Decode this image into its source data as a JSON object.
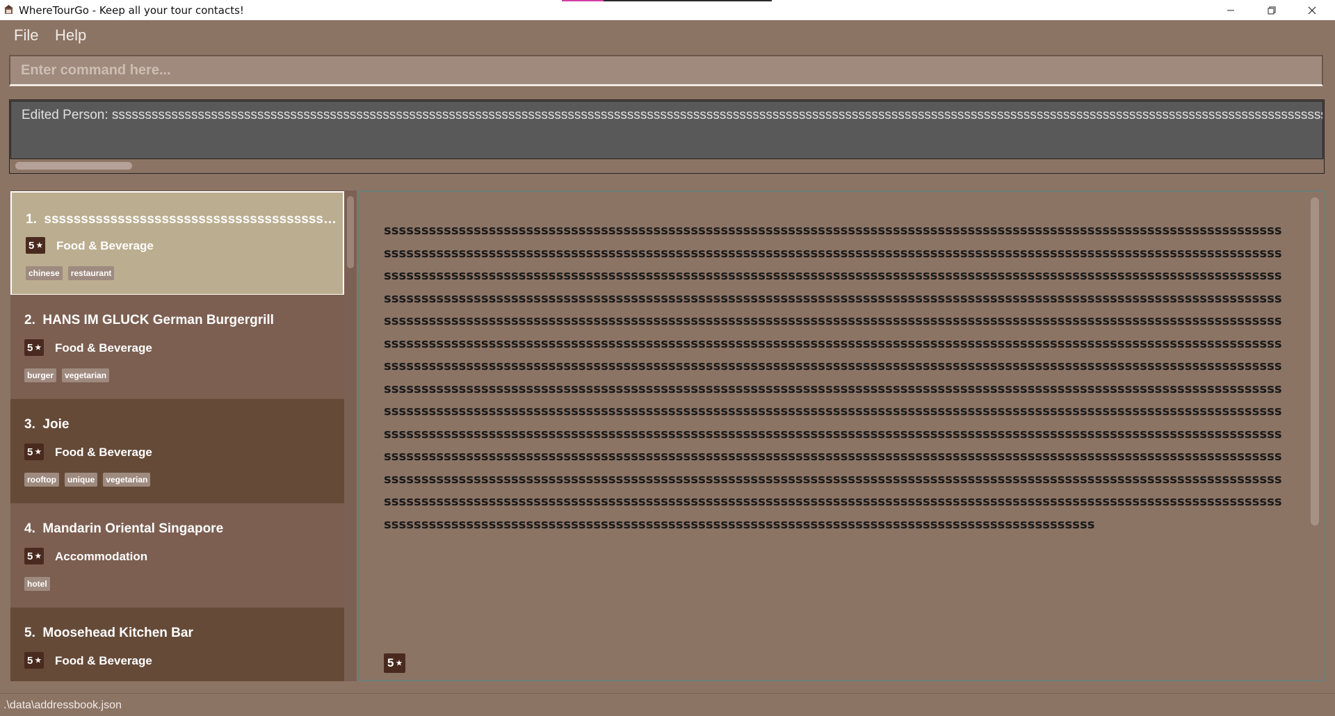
{
  "window": {
    "title": "WhereTourGo - Keep all your tour contacts!"
  },
  "menu": {
    "file": "File",
    "help": "Help"
  },
  "command": {
    "placeholder": "Enter command here..."
  },
  "result": {
    "message": "Edited Person: sssssssssssssssssssssssssssssssssssssssssssssssssssssssssssssssssssssssssssssssssssssssssssssssssssssssssssssssssssssssssssssssssssssssssssssssssssssssssssssssssssssssssssssssssssssssssssssssssssssssssssssssssssssssssssssssssssssssssssssss"
  },
  "list": {
    "items": [
      {
        "index": "1.",
        "name": "sssssssssssssssssssssssssssssssssssssssssssssssssssssss",
        "rating": "5",
        "category": "Food & Beverage",
        "tags": [
          "chinese",
          "restaurant"
        ]
      },
      {
        "index": "2.",
        "name": "HANS IM GLUCK German Burgergrill",
        "rating": "5",
        "category": "Food & Beverage",
        "tags": [
          "burger",
          "vegetarian"
        ]
      },
      {
        "index": "3.",
        "name": "Joie",
        "rating": "5",
        "category": "Food & Beverage",
        "tags": [
          "rooftop",
          "unique",
          "vegetarian"
        ]
      },
      {
        "index": "4.",
        "name": "Mandarin Oriental Singapore",
        "rating": "5",
        "category": "Accommodation",
        "tags": [
          "hotel"
        ]
      },
      {
        "index": "5.",
        "name": "Moosehead Kitchen Bar",
        "rating": "5",
        "category": "Food & Beverage",
        "tags": []
      }
    ]
  },
  "detail": {
    "text": "sssssssssssssssssssssssssssssssssssssssssssssssssssssssssssssssssssssssssssssssssssssssssssssssssssssssssssssssssssssssssssssssssssssssssssssssssssssssssssssssssssssssssssssssssssssssssssssssssssssssssssssssssssssssssssssssssssssssssssssssssssssssssssssssssssssssssssssssssssssssssssssssssssssssssssssssssssssssssssssssssssssssssssssssssssssssssssssssssssssssssssssssssssssssssssssssssssssssssssssssssssssssssssssssssssssssssssssssssssssssssssssssssssssssssssssssssssssssssssssssssssssssssssssssssssssssssssssssssssssssssssssssssssssssssssssssssssssssssssssssssssssssssssssssssssssssssssssssssssssssssssssssssssssssssssssssssssssssssssssssssssssssssssssssssssssssssssssssssssssssssssssssssssssssssssssssssssssssssssssssssssssssssssssssssssssssssssssssssssssssssssssssssssssssssssssssssssssssssssssssssssssssssssssssssssssssssssssssssssssssssssssssssssssssssssssssssssssssssssssssssssssssssssssssssssssssssssssssssssssssssssssssssssssssssssssssssssssssssssssssssssssssssssssssssssssssssssssssssssssssssssssssssssssssssssssssssssssssssssssssssssssssssssssssssssssssssssssssssssssssssssssssssssssssssssssssssssssssssssssssssssssssssssssssssssssssssssssssssssssssssssssssssssssssssssssssssssssssssssssssssssssssssssssssssssssssssssssssssssssssssssssssssssssssssssssssssssssssssssssssssssssssssssssssssssssssssssssssssssssssssssssssssssssssssssssssssssssssssssssssssssssssssssssssssssssssssssssssssssssssssssssssssssssssssssssssssssssssssssssssssssssssssssssssssssssssssssssssssssssssssssssssssssssssssssssssssssssssssssssssssssssssssssssssssssssssssssssssssssssssssssssssssssssssssssssssssssssssssssssssssssssssssssssssssssssssssssssssssssssssssssssssssssssss",
    "rating": "5"
  },
  "status": {
    "path": ".\\data\\addressbook.json"
  }
}
